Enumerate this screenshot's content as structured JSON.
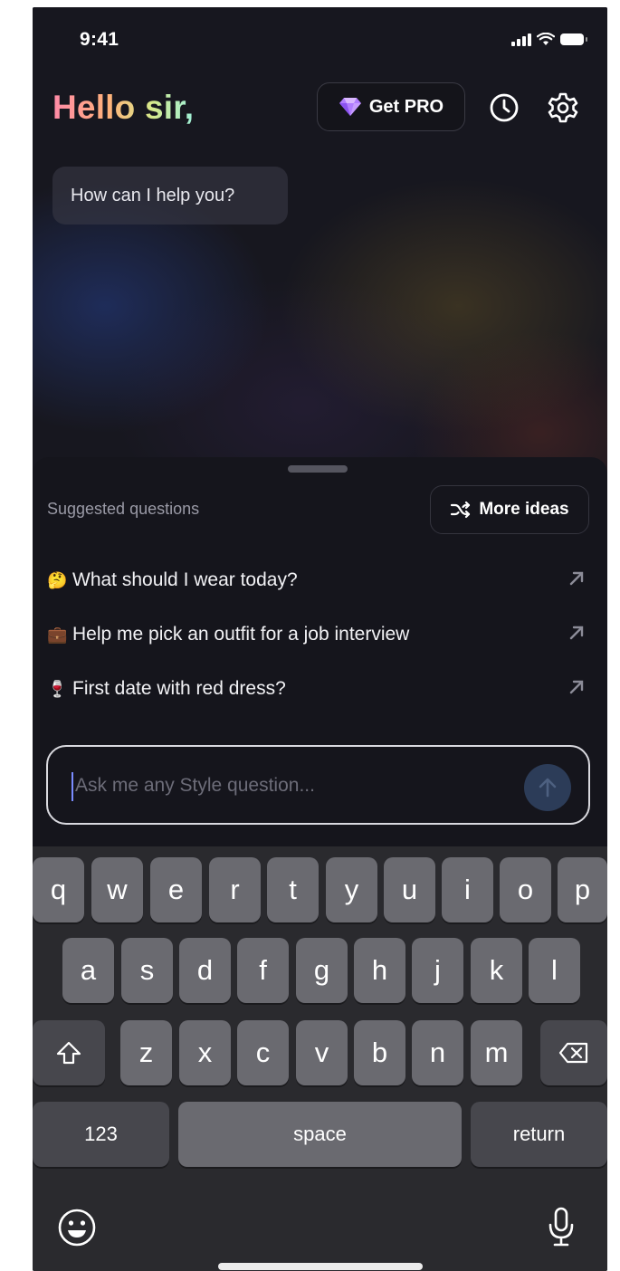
{
  "status_bar": {
    "time": "9:41"
  },
  "header": {
    "greeting": "Hello sir,",
    "pro_label": "Get PRO"
  },
  "chat": {
    "assistant_message": "How can I help you?"
  },
  "suggestions": {
    "title": "Suggested questions",
    "more_label": "More ideas",
    "items": [
      {
        "emoji": "🤔",
        "text": "What should I wear today?"
      },
      {
        "emoji": "💼",
        "text": "Help me pick an outfit for a job interview"
      },
      {
        "emoji": "🍷",
        "text": "First date with red dress?"
      }
    ]
  },
  "input": {
    "placeholder": "Ask me any Style question..."
  },
  "keyboard": {
    "row1": [
      "q",
      "w",
      "e",
      "r",
      "t",
      "y",
      "u",
      "i",
      "o",
      "p"
    ],
    "row2": [
      "a",
      "s",
      "d",
      "f",
      "g",
      "h",
      "j",
      "k",
      "l"
    ],
    "row3": [
      "z",
      "x",
      "c",
      "v",
      "b",
      "n",
      "m"
    ],
    "numbers_label": "123",
    "space_label": "space",
    "return_label": "return"
  },
  "icons": {
    "pro": "diamond-icon",
    "history": "clock-icon",
    "settings": "gear-icon",
    "more": "shuffle-icon",
    "suggestion_arrow": "arrow-up-right-icon",
    "send": "arrow-up-icon",
    "shift": "shift-icon",
    "delete": "backspace-icon",
    "emoji": "emoji-icon",
    "dictation": "microphone-icon"
  },
  "colors": {
    "background": "#15151c",
    "greeting_gradient": [
      "#ff8aa8",
      "#ffb27a",
      "#d7e98a",
      "#9ff0d8"
    ],
    "send_button": "#2c3c58",
    "key": "#6a6a70",
    "key_dark": "#47474d"
  }
}
